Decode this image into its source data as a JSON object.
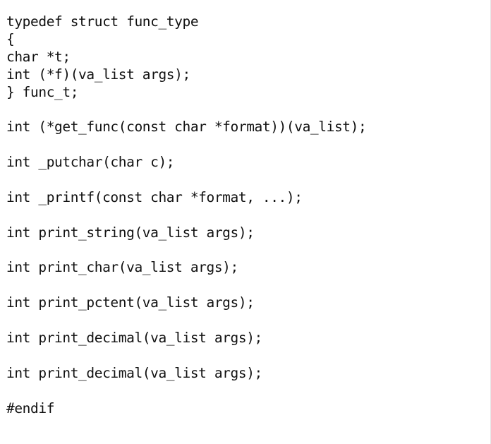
{
  "editor": {
    "lines": [
      "typedef struct func_type",
      "{",
      "char *t;",
      "int (*f)(va_list args);",
      "} func_t;",
      "",
      "int (*get_func(const char *format))(va_list);",
      "",
      "int _putchar(char c);",
      "",
      "int _printf(const char *format, ...);",
      "",
      "int print_string(va_list args);",
      "",
      "int print_char(va_list args);",
      "",
      "int print_pctent(va_list args);",
      "",
      "int print_decimal(va_list args);",
      "",
      "int print_decimal(va_list args);",
      "",
      "#endif"
    ]
  }
}
